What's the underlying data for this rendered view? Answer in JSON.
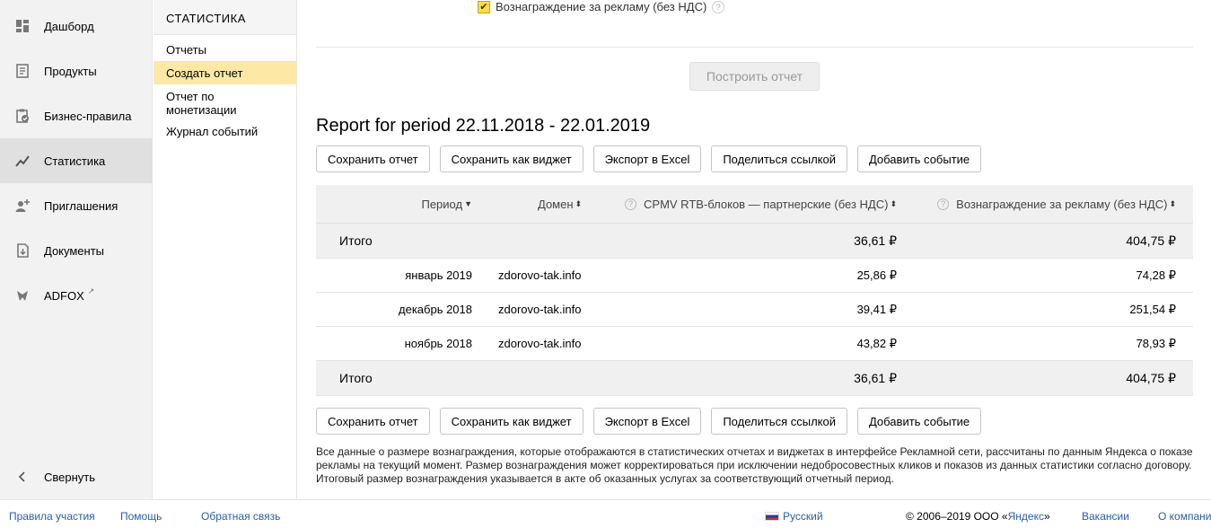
{
  "nav": {
    "items": [
      {
        "label": "Дашборд",
        "icon": "dashboard-icon"
      },
      {
        "label": "Продукты",
        "icon": "products-icon"
      },
      {
        "label": "Бизнес-правила",
        "icon": "business-rules-icon"
      },
      {
        "label": "Статистика",
        "icon": "statistics-icon"
      },
      {
        "label": "Приглашения",
        "icon": "invite-icon"
      },
      {
        "label": "Документы",
        "icon": "documents-icon"
      },
      {
        "label": "ADFOX",
        "icon": "adfox-icon"
      }
    ],
    "collapse_label": "Свернуть"
  },
  "subnav": {
    "title": "СТАТИСТИКА",
    "items": [
      {
        "label": "Отчеты"
      },
      {
        "label": "Создать отчет"
      },
      {
        "label": "Отчет по монетизации"
      },
      {
        "label": "Журнал событий"
      }
    ]
  },
  "main": {
    "checkbox_label": "Вознаграждение за рекламу (без НДС)",
    "checkbox_checked": true,
    "build_button": "Построить отчет",
    "report_title": "Report for period 22.11.2018 - 22.01.2019"
  },
  "actions": {
    "save": "Сохранить отчет",
    "save_widget": "Сохранить как виджет",
    "export_excel": "Экспорт в Excel",
    "share_link": "Поделиться ссылкой",
    "add_event": "Добавить событие"
  },
  "table": {
    "columns": {
      "period": "Период",
      "domain": "Домен",
      "cpmv": "CPMV RTB-блоков — партнерские (без НДС)",
      "reward": "Вознаграждение за рекламу (без НДС)"
    },
    "total_top": {
      "label": "Итого",
      "cpmv": "36,61 ₽",
      "reward": "404,75 ₽"
    },
    "rows": [
      {
        "period": "январь 2019",
        "domain": "zdorovo-tak.info",
        "cpmv": "25,86 ₽",
        "reward": "74,28 ₽"
      },
      {
        "period": "декабрь 2018",
        "domain": "zdorovo-tak.info",
        "cpmv": "39,41 ₽",
        "reward": "251,54 ₽"
      },
      {
        "period": "ноябрь 2018",
        "domain": "zdorovo-tak.info",
        "cpmv": "43,82 ₽",
        "reward": "78,93 ₽"
      }
    ],
    "total_bottom": {
      "label": "Итого",
      "cpmv": "36,61 ₽",
      "reward": "404,75 ₽"
    }
  },
  "note": "Все данные о размере вознаграждения, которые отображаются в статистических отчетах и виджетах в интерфейсе Рекламной сети, рассчитаны по данным Яндекса о показе рекламы на текущий момент. Размер вознаграждения может корректироваться при исключении недобросовестных кликов и показов из данных статистики согласно договору. Итоговый размер вознаграждения указывается в акте об оказанных услугах за соответствующий отчетный период.",
  "footer": {
    "rules": "Правила участия",
    "help": "Помощь",
    "feedback": "Обратная связь",
    "language": "Русский",
    "copyright_prefix": "© 2006–2019  ООО «",
    "copyright_link": "Яндекс",
    "copyright_suffix": "»",
    "vacancies": "Вакансии",
    "about": "О компании"
  },
  "colors": {
    "active_subnav": "#fde9a5",
    "checkbox": "#ffdb4d",
    "link": "#2a5ea8"
  }
}
